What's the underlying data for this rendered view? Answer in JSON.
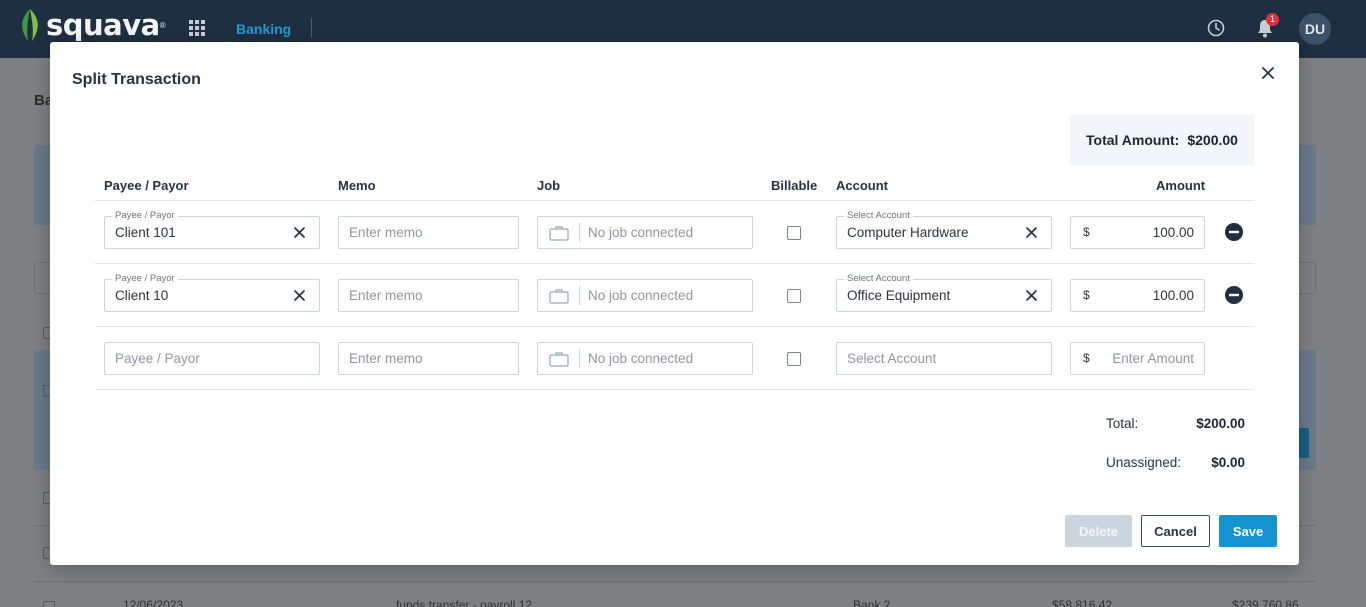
{
  "app": {
    "brand": "squava",
    "nav_active": "Banking",
    "notification_count": "1",
    "user_initials": "DU"
  },
  "background": {
    "page_title_fragment": "Ba",
    "row": {
      "date": "12/06/2023",
      "description": "funds transfer - payroll 12",
      "account": "Bank 2",
      "amount": "$58,816.42",
      "balance": "$239,760.86"
    }
  },
  "modal": {
    "title": "Split Transaction",
    "total_amount_label": "Total Amount:",
    "total_amount_value": "$200.00",
    "columns": {
      "payee": "Payee / Payor",
      "memo": "Memo",
      "job": "Job",
      "billable": "Billable",
      "account": "Account",
      "amount": "Amount"
    },
    "rows": [
      {
        "payee_label": "Payee / Payor",
        "payee": "Client 101",
        "memo_placeholder": "Enter memo",
        "job_placeholder": "No job connected",
        "billable": false,
        "account_label": "Select Account",
        "account": "Computer Hardware",
        "currency": "$",
        "amount": "100.00"
      },
      {
        "payee_label": "Payee / Payor",
        "payee": "Client 10",
        "memo_placeholder": "Enter memo",
        "job_placeholder": "No job connected",
        "billable": false,
        "account_label": "Select Account",
        "account": "Office Equipment",
        "currency": "$",
        "amount": "100.00"
      },
      {
        "payee_placeholder": "Payee / Payor",
        "memo_placeholder": "Enter memo",
        "job_placeholder": "No job connected",
        "billable": false,
        "account_placeholder": "Select Account",
        "currency": "$",
        "amount_placeholder": "Enter Amount"
      }
    ],
    "summary": {
      "total_label": "Total:",
      "total_value": "$200.00",
      "unassigned_label": "Unassigned:",
      "unassigned_value": "$0.00"
    },
    "buttons": {
      "delete": "Delete",
      "cancel": "Cancel",
      "save": "Save"
    }
  },
  "icons": [
    "leaf-logo-icon",
    "apps-grid-icon",
    "clock-icon",
    "bell-icon",
    "close-icon",
    "clear-icon",
    "briefcase-icon",
    "minus-circle-icon"
  ],
  "colors": {
    "topbar": "#1e2f41",
    "accent": "#1592d0",
    "nav_active": "#1e9cd7",
    "remove_icon": "#1e2f41",
    "delete_disabled": "#c9d6e0"
  }
}
